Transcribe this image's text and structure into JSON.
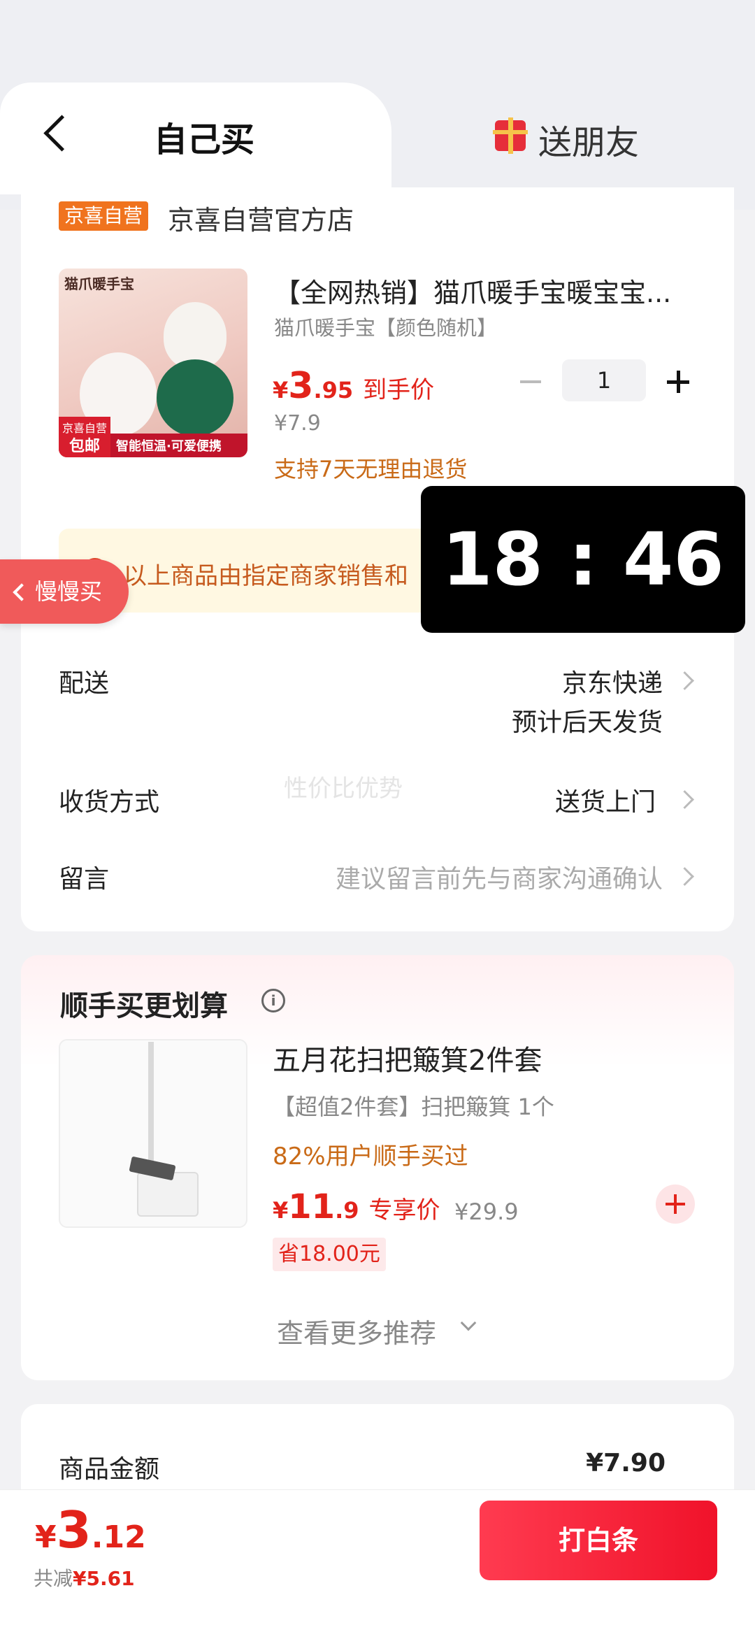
{
  "tabs": {
    "self_label": "自己买",
    "friend_label": "送朋友"
  },
  "store": {
    "badge": "京喜自营",
    "name": "京喜自营官方店"
  },
  "product": {
    "image_label": "猫爪暖手宝",
    "image_stamp_top": "京喜自营",
    "image_stamp_bottom": "包邮",
    "image_slogan": "智能恒温·可爱便携",
    "title": "【全网热销】猫爪暖手宝暖宝宝...",
    "spec": "猫爪暖手宝【颜色随机】",
    "price_symbol": "¥",
    "price_int": "3",
    "price_dec": ".95",
    "price_tag": "到手价",
    "original_price": "¥7.9",
    "return_policy": "支持7天无理由退货",
    "quantity": "1"
  },
  "notice": {
    "icon": "i",
    "text": "以上商品由指定商家销售和"
  },
  "slow_buy": "慢慢买",
  "timer": "18 : 46",
  "rows": {
    "delivery_label": "配送",
    "delivery_value": "京东快递",
    "delivery_note": "预计后天发货",
    "receive_label": "收货方式",
    "receive_value": "送货上门",
    "message_label": "留言",
    "message_placeholder": "建议留言前先与商家沟通确认"
  },
  "watermark": "性价比优势",
  "recommend": {
    "title": "顺手买更划算",
    "info_icon": "i",
    "name": "五月花扫把簸箕2件套",
    "spec": "【超值2件套】扫把簸箕 1个",
    "bought": "82%用户顺手买过",
    "price_symbol": "¥",
    "price_int": "11",
    "price_dec": ".9",
    "price_tag": "专享价",
    "original_price": "¥29.9",
    "save": "省18.00元",
    "more": "查看更多推荐"
  },
  "amount": {
    "label": "商品金额",
    "value": "¥7.90"
  },
  "bottom": {
    "price_symbol": "¥",
    "price_int": "3",
    "price_dec": ".12",
    "save_prefix": "共减",
    "save_amount": "¥5.61",
    "pay_button": "打白条"
  },
  "colors": {
    "accent_red": "#e2231a",
    "store_badge": "#f0731e",
    "notice_bg": "#fff8e2"
  }
}
